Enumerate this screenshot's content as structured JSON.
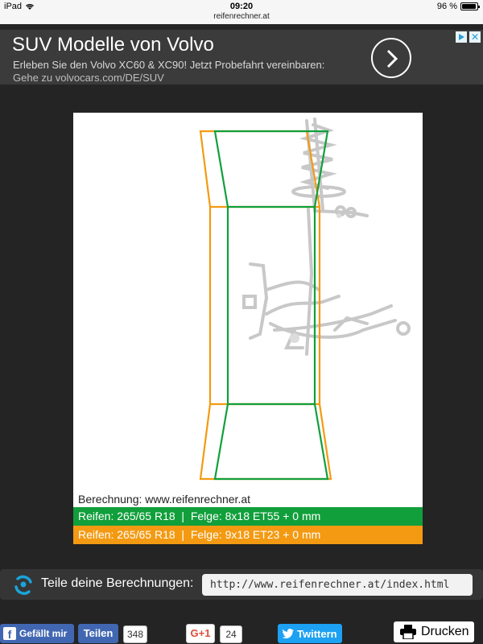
{
  "status_bar": {
    "device": "iPad",
    "time": "09:20",
    "url": "reifenrechner.at",
    "battery": "96 %",
    "battery_level": 0.96,
    "icons": [
      "wifi-icon",
      "battery-icon"
    ]
  },
  "ad": {
    "title": "SUV Modelle von Volvo",
    "text": "Erleben Sie den Volvo XC60 & XC90! Jetzt Probefahrt vereinbaren:",
    "url_text": "Gehe zu volvocars.com/DE/SUV",
    "icons": [
      "chevron-right-icon",
      "ad-choices-icon",
      "close-icon"
    ]
  },
  "diagram": {
    "credit": "Berechnung: www.reifenrechner.at",
    "legend": [
      {
        "text": "Reifen: 265/65 R18  |  Felge: 8x18 ET55 + 0 mm",
        "color": "#119f3b"
      },
      {
        "text": "Reifen: 265/65 R18  |  Felge: 9x18 ET23 + 0 mm",
        "color": "#f39a12"
      }
    ]
  },
  "share": {
    "label": "Teile deine Berechnungen:",
    "url": "http://www.reifenrechner.at/index.html",
    "icon": "share-icon"
  },
  "footer": {
    "facebook_like": "Gefällt mir",
    "facebook_share": "Teilen",
    "facebook_count": "348",
    "gplus_label": "G+1",
    "gplus_count": "24",
    "twitter": "Twittern",
    "print": "Drucken"
  },
  "colors": {
    "background": "#242424",
    "green": "#119f3b",
    "orange": "#f39a12",
    "facebook": "#4267b2",
    "twitter": "#1da1f2"
  }
}
